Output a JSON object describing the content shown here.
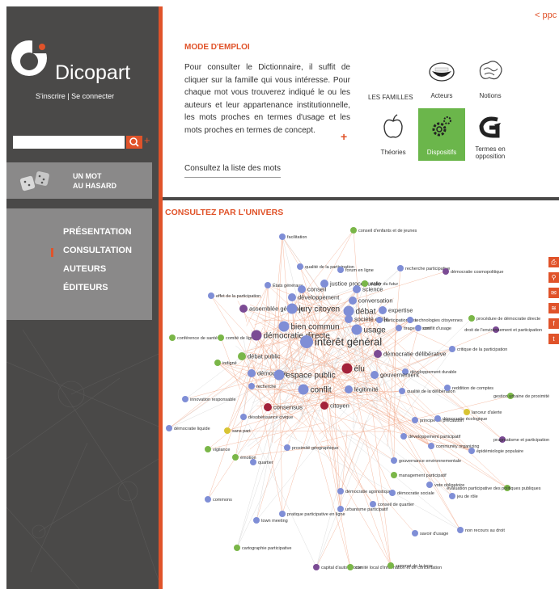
{
  "sidebar": {
    "logo_text": "Dicopart",
    "login_text": "S'inscrire | Se connecter",
    "search": {
      "placeholder": "",
      "value": ""
    },
    "hasard_label": "UN MOT\nAU HASARD",
    "menu": [
      {
        "label": "PRÉSENTATION",
        "active": false
      },
      {
        "label": "CONSULTATION",
        "active": true
      },
      {
        "label": "AUTEURS",
        "active": false
      },
      {
        "label": "ÉDITEURS",
        "active": false
      }
    ]
  },
  "top_link": "< ppc",
  "mode_emploi": {
    "title": "MODE D'EMPLOI",
    "text": "Pour consulter le Dictionnaire, il suffit de cliquer sur la famille qui vous intéresse. Pour chaque mot vous trouverez indiqué le ou les auteurs et leur appartenance institutionnelle, les mots proches en termes d'usage et les mots proches en termes de concept.",
    "plus": "+",
    "list_link": "Consultez la liste des mots"
  },
  "familles": {
    "label": "LES FAMILLES",
    "items": [
      {
        "label": "Acteurs",
        "icon": "mouth-icon",
        "active": false
      },
      {
        "label": "Notions",
        "icon": "brain-icon",
        "active": false
      },
      {
        "label": "Théories",
        "icon": "apple-icon",
        "active": false
      },
      {
        "label": "Dispositifs",
        "icon": "gears-icon",
        "active": true
      },
      {
        "label": "Termes en opposition",
        "icon": "g-arrow-icon",
        "active": false
      }
    ]
  },
  "univers_title": "CONSULTEZ PAR L'UNIVERS",
  "colors": {
    "accent": "#e0532a",
    "sidebar": "#4a4948",
    "panel_grey": "#8a8989",
    "active_green": "#6bb64b",
    "node_blue": "#7f8ed6",
    "node_purple": "#7b4b94",
    "node_green": "#7ab648",
    "node_red": "#a3223a",
    "node_yellow": "#d8c433"
  },
  "graph": {
    "nodes": [
      {
        "label": "facilitation",
        "c": "blue",
        "s": 1
      },
      {
        "label": "conseil d'enfants et de jeunes",
        "c": "green",
        "s": 1
      },
      {
        "label": "qualité de la participation",
        "c": "blue",
        "s": 1
      },
      {
        "label": "forum en ligne",
        "c": "blue",
        "s": 1
      },
      {
        "label": "recherche participative",
        "c": "blue",
        "s": 1
      },
      {
        "label": "démocratie cosmopolitique",
        "c": "purple",
        "s": 1
      },
      {
        "label": "États généraux",
        "c": "blue",
        "s": 1
      },
      {
        "label": "conseil",
        "c": "blue",
        "s": 2
      },
      {
        "label": "justice procédurale",
        "c": "blue",
        "s": 2
      },
      {
        "label": "atelier du futur",
        "c": "green",
        "s": 1
      },
      {
        "label": "science",
        "c": "blue",
        "s": 2
      },
      {
        "label": "effet de la participation",
        "c": "blue",
        "s": 1
      },
      {
        "label": "développement",
        "c": "blue",
        "s": 2
      },
      {
        "label": "conversation",
        "c": "blue",
        "s": 2
      },
      {
        "label": "assemblée générale",
        "c": "purple",
        "s": 2
      },
      {
        "label": "jury citoyen",
        "c": "blue",
        "s": 3
      },
      {
        "label": "débat",
        "c": "blue",
        "s": 3
      },
      {
        "label": "expertise",
        "c": "blue",
        "s": 2
      },
      {
        "label": "société civile",
        "c": "blue",
        "s": 2
      },
      {
        "label": "participation des",
        "c": "blue",
        "s": 1
      },
      {
        "label": "technologies citoyennes",
        "c": "blue",
        "s": 1
      },
      {
        "label": "procédure de démocratie directe",
        "c": "green",
        "s": 1
      },
      {
        "label": "bien commun",
        "c": "blue",
        "s": 3
      },
      {
        "label": "usage",
        "c": "blue",
        "s": 3
      },
      {
        "label": "comité de ligne",
        "c": "green",
        "s": 1
      },
      {
        "label": "démocratie directe",
        "c": "purple",
        "s": 3
      },
      {
        "label": "intérêt général",
        "c": "blue",
        "s": 4
      },
      {
        "label": "tirage au sort",
        "c": "blue",
        "s": 1
      },
      {
        "label": "conflit d'usage",
        "c": "blue",
        "s": 1
      },
      {
        "label": "droit de l'environnement et participation",
        "c": "purple",
        "s": 1
      },
      {
        "label": "conférence de santé",
        "c": "green",
        "s": 1
      },
      {
        "label": "débat public",
        "c": "green",
        "s": 2
      },
      {
        "label": "démocratie délibérative",
        "c": "purple",
        "s": 2
      },
      {
        "label": "indigné",
        "c": "green",
        "s": 1
      },
      {
        "label": "démocratie",
        "c": "blue",
        "s": 2
      },
      {
        "label": "élu",
        "c": "red",
        "s": 3
      },
      {
        "label": "développement durable",
        "c": "blue",
        "s": 1
      },
      {
        "label": "critique de la participation",
        "c": "blue",
        "s": 1
      },
      {
        "label": "espace public",
        "c": "blue",
        "s": 3
      },
      {
        "label": "gouvernement",
        "c": "blue",
        "s": 2
      },
      {
        "label": "recherche",
        "c": "blue",
        "s": 1
      },
      {
        "label": "conflit",
        "c": "blue",
        "s": 3
      },
      {
        "label": "légitimité",
        "c": "blue",
        "s": 2
      },
      {
        "label": "gestion urbaine de proximité",
        "c": "green",
        "s": 1
      },
      {
        "label": "innovation responsable",
        "c": "blue",
        "s": 1
      },
      {
        "label": "consensus",
        "c": "red",
        "s": 2
      },
      {
        "label": "citoyen",
        "c": "red",
        "s": 2
      },
      {
        "label": "qualité de la délibération",
        "c": "blue",
        "s": 1
      },
      {
        "label": "reddition de comptes",
        "c": "blue",
        "s": 1
      },
      {
        "label": "lanceur d'alerte",
        "c": "yellow",
        "s": 1
      },
      {
        "label": "désobéissance civique",
        "c": "blue",
        "s": 1
      },
      {
        "label": "principe de précaution",
        "c": "blue",
        "s": 1
      },
      {
        "label": "démocratie écologique",
        "c": "blue",
        "s": 1
      },
      {
        "label": "démocratie liquide",
        "c": "blue",
        "s": 1
      },
      {
        "label": "sans part",
        "c": "yellow",
        "s": 1
      },
      {
        "label": "pragmatisme et participation",
        "c": "purple",
        "s": 1
      },
      {
        "label": "développement participatif",
        "c": "blue",
        "s": 1
      },
      {
        "label": "vigilance",
        "c": "green",
        "s": 1
      },
      {
        "label": "émotion",
        "c": "green",
        "s": 1
      },
      {
        "label": "proximité géographique",
        "c": "blue",
        "s": 1
      },
      {
        "label": "community organizing",
        "c": "blue",
        "s": 1
      },
      {
        "label": "épidémiologie populaire",
        "c": "blue",
        "s": 1
      },
      {
        "label": "quartier",
        "c": "blue",
        "s": 1
      },
      {
        "label": "gouvernance environnementale",
        "c": "blue",
        "s": 1
      },
      {
        "label": "évaluation participative des politiques publiques",
        "c": "green",
        "s": 1
      },
      {
        "label": "management participatif",
        "c": "green",
        "s": 1
      },
      {
        "label": "vote obligatoire",
        "c": "blue",
        "s": 1
      },
      {
        "label": "jeu de rôle",
        "c": "blue",
        "s": 1
      },
      {
        "label": "démocratie agonistique",
        "c": "blue",
        "s": 1
      },
      {
        "label": "démocratie sociale",
        "c": "blue",
        "s": 1
      },
      {
        "label": "commons",
        "c": "blue",
        "s": 1
      },
      {
        "label": "town meeting",
        "c": "blue",
        "s": 1
      },
      {
        "label": "pratique participative en ligne",
        "c": "blue",
        "s": 1
      },
      {
        "label": "urbanisme participatif",
        "c": "blue",
        "s": 1
      },
      {
        "label": "conseil de quartier",
        "c": "blue",
        "s": 1
      },
      {
        "label": "savoir d'usage",
        "c": "blue",
        "s": 1
      },
      {
        "label": "non recours au droit",
        "c": "blue",
        "s": 1
      },
      {
        "label": "cartographie participative",
        "c": "green",
        "s": 1
      },
      {
        "label": "capital d'autochtonie",
        "c": "purple",
        "s": 1
      },
      {
        "label": "comité local d'information et de concertation",
        "c": "green",
        "s": 1
      },
      {
        "label": "sommet de la terre",
        "c": "green",
        "s": 1
      }
    ]
  }
}
